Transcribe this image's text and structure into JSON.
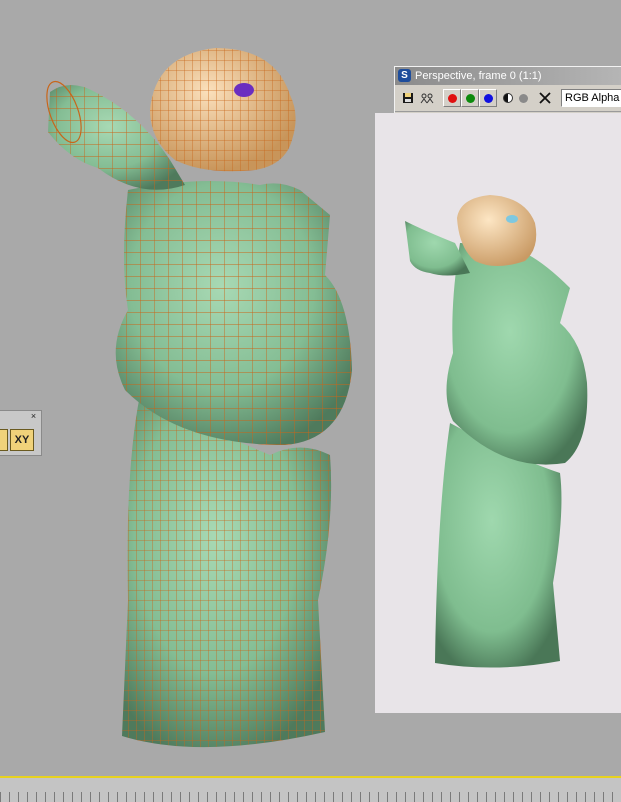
{
  "render_window": {
    "title": "Perspective, frame 0 (1:1)",
    "app_icon": "3ds-max-icon",
    "channel_display": "RGB Alpha",
    "toolbar": [
      {
        "name": "save-image-icon"
      },
      {
        "name": "clone-window-icon"
      },
      {
        "name": "red-channel-toggle",
        "color": "#e01010"
      },
      {
        "name": "green-channel-toggle",
        "color": "#0c8a0c"
      },
      {
        "name": "blue-channel-toggle",
        "color": "#1010e0"
      },
      {
        "name": "mono-channel-icon"
      },
      {
        "name": "alpha-channel-icon"
      },
      {
        "name": "clear-icon"
      }
    ]
  },
  "axis_toolbar": {
    "close_glyph": "×",
    "active_constraint": "XY"
  },
  "colors": {
    "viewport_bg": "#a9a9a9",
    "mesh_wire": "#c8661a",
    "shirt": "#8cc39c",
    "skin": "#f0c89a",
    "timeline_accent": "#e7d21e"
  }
}
